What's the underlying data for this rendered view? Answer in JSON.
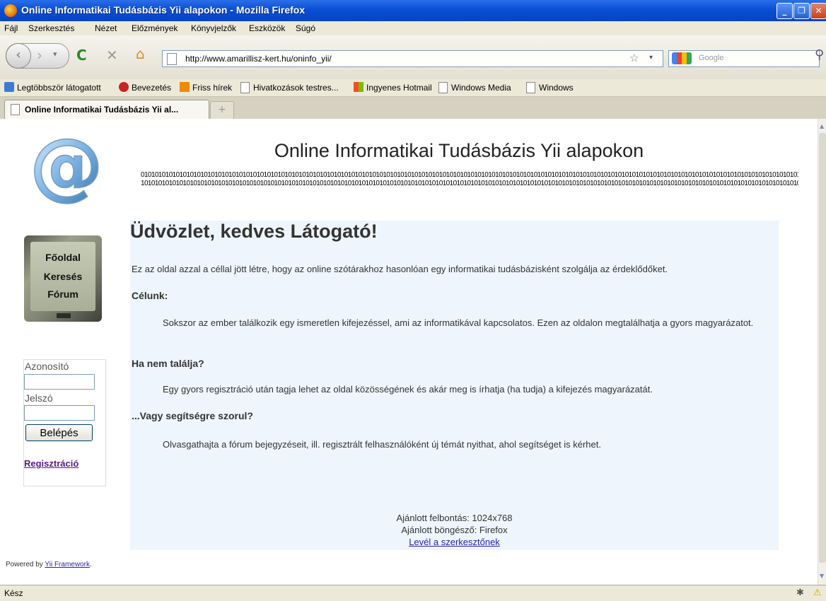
{
  "window": {
    "title": "Online Informatikai Tudásbázis Yii alapokon - Mozilla Firefox"
  },
  "menu": [
    "Fájl",
    "Szerkesztés",
    "Nézet",
    "Előzmények",
    "Könyvjelzők",
    "Eszközök",
    "Súgó"
  ],
  "navbar": {
    "url": "http://www.amarillisz-kert.hu/oninfo_yii/",
    "search_placeholder": "Google"
  },
  "bookmarks": [
    "Legtöbbször látogatott",
    "Bevezetés",
    "Friss hírek",
    "Hivatkozások testres...",
    "Ingyenes Hotmail",
    "Windows Media",
    "Windows"
  ],
  "tab": {
    "label": "Online Informatikai Tudásbázis Yii al...",
    "new_tab": "+"
  },
  "site": {
    "title": "Online Informatikai Tudásbázis Yii alapokon",
    "binary_1": "0101010101010101010101010101010101010101010101010101010101010101010101010101010101010101010101010101010101010101010101010101010101010101010101010101010101010101010101010101010101010101010101",
    "binary_2": "1010101010101010101010101010101010101010101010101010101010101010101010101010101010101010101010101010101010101010101010101010101010101010101010101010101010101010101010101010101010101010101010"
  },
  "sidebar": {
    "menu": [
      "Főoldal",
      "Keresés",
      "Fórum"
    ],
    "login": {
      "username_label": "Azonosító",
      "password_label": "Jelszó",
      "button": "Belépés",
      "register": "Regisztráció"
    }
  },
  "main": {
    "heading": "Üdvözlet, kedves Látogató!",
    "intro": "Ez az oldal azzal a céllal jött létre, hogy az online szótárakhoz hasonlóan egy informatikai tudásbázisként szolgálja az érdeklődőket.",
    "sections": [
      {
        "title": "Célunk:",
        "text": "Sokszor az ember találkozik egy ismeretlen kifejezéssel, ami az informatikával kapcsolatos. Ezen az oldalon megtalálhatja a gyors magyarázatot."
      },
      {
        "title": "Ha nem találja?",
        "text": "Egy gyors regisztráció után tagja lehet az oldal közösségének és akár meg is írhatja (ha tudja) a kifejezés magyarázatát."
      },
      {
        "title": "...Vagy segítségre szorul?",
        "text": "Olvasgathajta a fórum bejegyzéseit, ill. regisztrált felhasználóként új témát nyithat, ahol segítséget is kérhet."
      }
    ],
    "footer": {
      "resolution": "Ajánlott felbontás: 1024x768",
      "browser": "Ajánlott böngésző: Firefox",
      "contact": "Levél a szerkesztőnek"
    }
  },
  "powered": {
    "prefix": "Powered by",
    "link": "Yii Framework",
    "suffix": "."
  },
  "status": "Kész"
}
